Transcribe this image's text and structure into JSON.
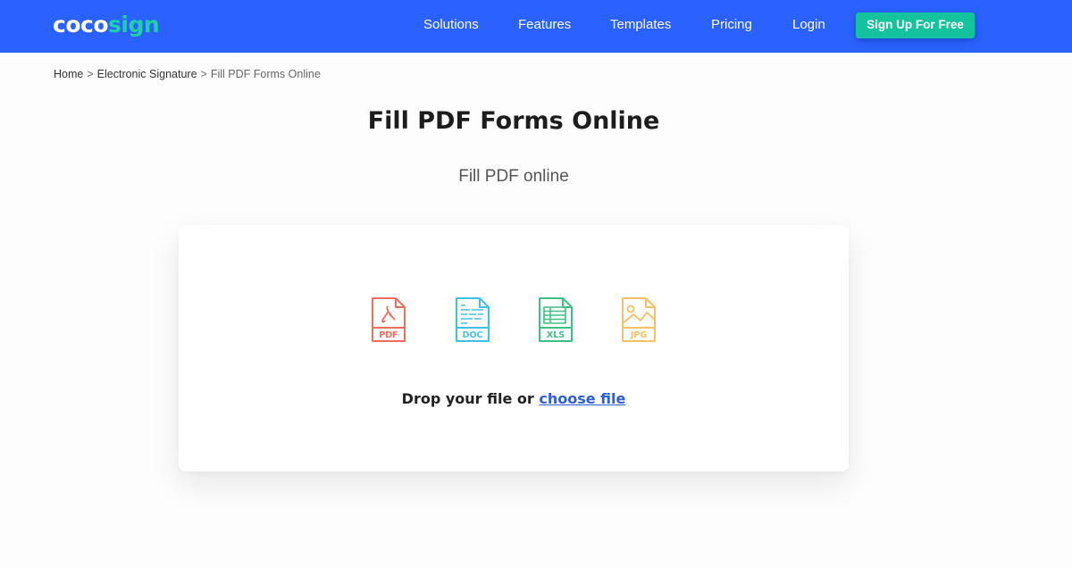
{
  "header": {
    "logo": {
      "part1": "coco",
      "part2": "sign"
    },
    "nav": [
      "Solutions",
      "Features",
      "Templates",
      "Pricing",
      "Login"
    ],
    "cta_label": "Sign Up For Free"
  },
  "breadcrumb": {
    "items": [
      "Home",
      "Electronic Signature",
      "Fill PDF Forms Online"
    ],
    "separator": ">"
  },
  "main": {
    "title": "Fill PDF Forms Online",
    "subtitle": "Fill PDF online"
  },
  "upload": {
    "file_types": [
      {
        "label": "PDF",
        "icon": "pdf-file-icon",
        "color": "#ef6f5e"
      },
      {
        "label": "DOC",
        "icon": "doc-file-icon",
        "color": "#3fc1e6"
      },
      {
        "label": "XLS",
        "icon": "xls-file-icon",
        "color": "#3dbf86"
      },
      {
        "label": "JPG",
        "icon": "jpg-file-icon",
        "color": "#f5c066"
      }
    ],
    "drop_text": "Drop your file or",
    "choose_link": "choose file"
  },
  "colors": {
    "brand_blue": "#2962ff",
    "brand_green": "#14c39d",
    "link": "#2d5fd8"
  }
}
